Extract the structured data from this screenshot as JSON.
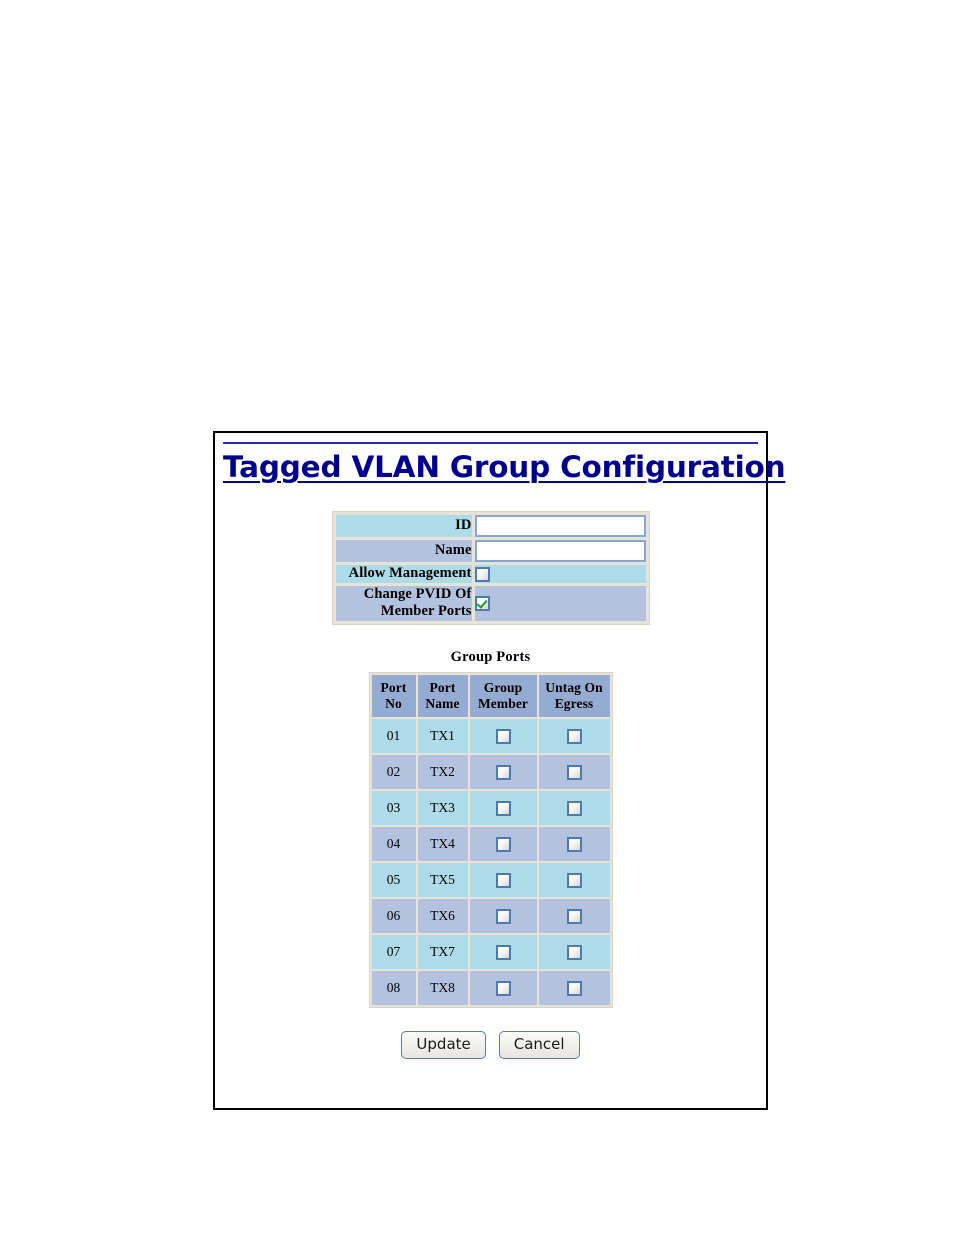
{
  "page": {
    "title": "Tagged VLAN Group Configuration"
  },
  "form": {
    "rows": [
      {
        "label": "ID",
        "type": "text",
        "value": "",
        "placeholder": ""
      },
      {
        "label": "Name",
        "type": "text",
        "value": "",
        "placeholder": ""
      },
      {
        "label": "Allow Management",
        "type": "checkbox",
        "checked": false
      },
      {
        "label": "Change PVID Of Member Ports",
        "label_line1": "Change PVID Of",
        "label_line2": "Member Ports",
        "type": "checkbox",
        "checked": true
      }
    ]
  },
  "group_ports": {
    "caption": "Group Ports",
    "columns": [
      {
        "line1": "Port",
        "line2": "No"
      },
      {
        "line1": "Port",
        "line2": "Name"
      },
      {
        "line1": "Group",
        "line2": "Member"
      },
      {
        "line1": "Untag On",
        "line2": "Egress"
      }
    ],
    "rows": [
      {
        "port_no": "01",
        "port_name": "TX1",
        "group_member": false,
        "untag_on_egress": false
      },
      {
        "port_no": "02",
        "port_name": "TX2",
        "group_member": false,
        "untag_on_egress": false
      },
      {
        "port_no": "03",
        "port_name": "TX3",
        "group_member": false,
        "untag_on_egress": false
      },
      {
        "port_no": "04",
        "port_name": "TX4",
        "group_member": false,
        "untag_on_egress": false
      },
      {
        "port_no": "05",
        "port_name": "TX5",
        "group_member": false,
        "untag_on_egress": false
      },
      {
        "port_no": "06",
        "port_name": "TX6",
        "group_member": false,
        "untag_on_egress": false
      },
      {
        "port_no": "07",
        "port_name": "TX7",
        "group_member": false,
        "untag_on_egress": false
      },
      {
        "port_no": "08",
        "port_name": "TX8",
        "group_member": false,
        "untag_on_egress": false
      }
    ]
  },
  "buttons": {
    "update": "Update",
    "cancel": "Cancel"
  },
  "colors": {
    "title": "#00008f",
    "row_light": "#addbe8",
    "row_dark": "#b3c2de",
    "header": "#96abd2",
    "cell_gap": "#e7e3d6",
    "checkbox_border": "#4d7bb0",
    "check_mark": "#1c9e28",
    "frame_border": "#000000"
  }
}
